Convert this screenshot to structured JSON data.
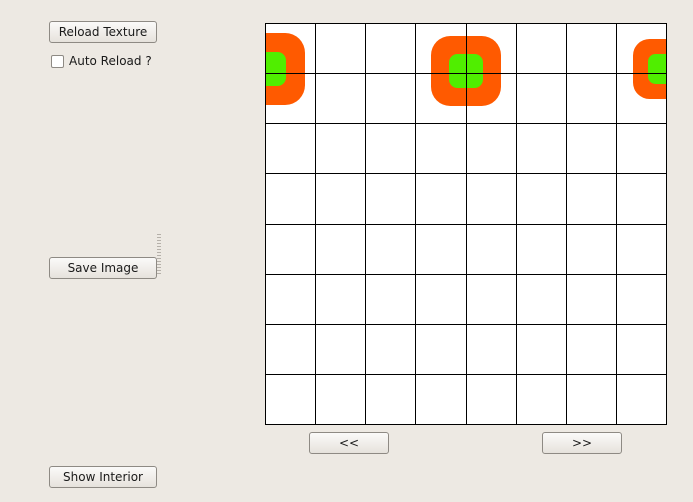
{
  "controls": {
    "reload_texture_label": "Reload Texture",
    "auto_reload_label": "Auto Reload ?",
    "auto_reload_checked": false,
    "save_image_label": "Save Image",
    "show_interior_label": "Show Interior"
  },
  "navigation": {
    "prev_label": "<<",
    "next_label": ">>"
  },
  "texture_view": {
    "grid_rows": 8,
    "grid_cols": 8,
    "line_color": "#000000",
    "background_color": "#ffffff",
    "blob_outer_color": "#ff5a00",
    "blob_inner_color": "#50ee00"
  }
}
